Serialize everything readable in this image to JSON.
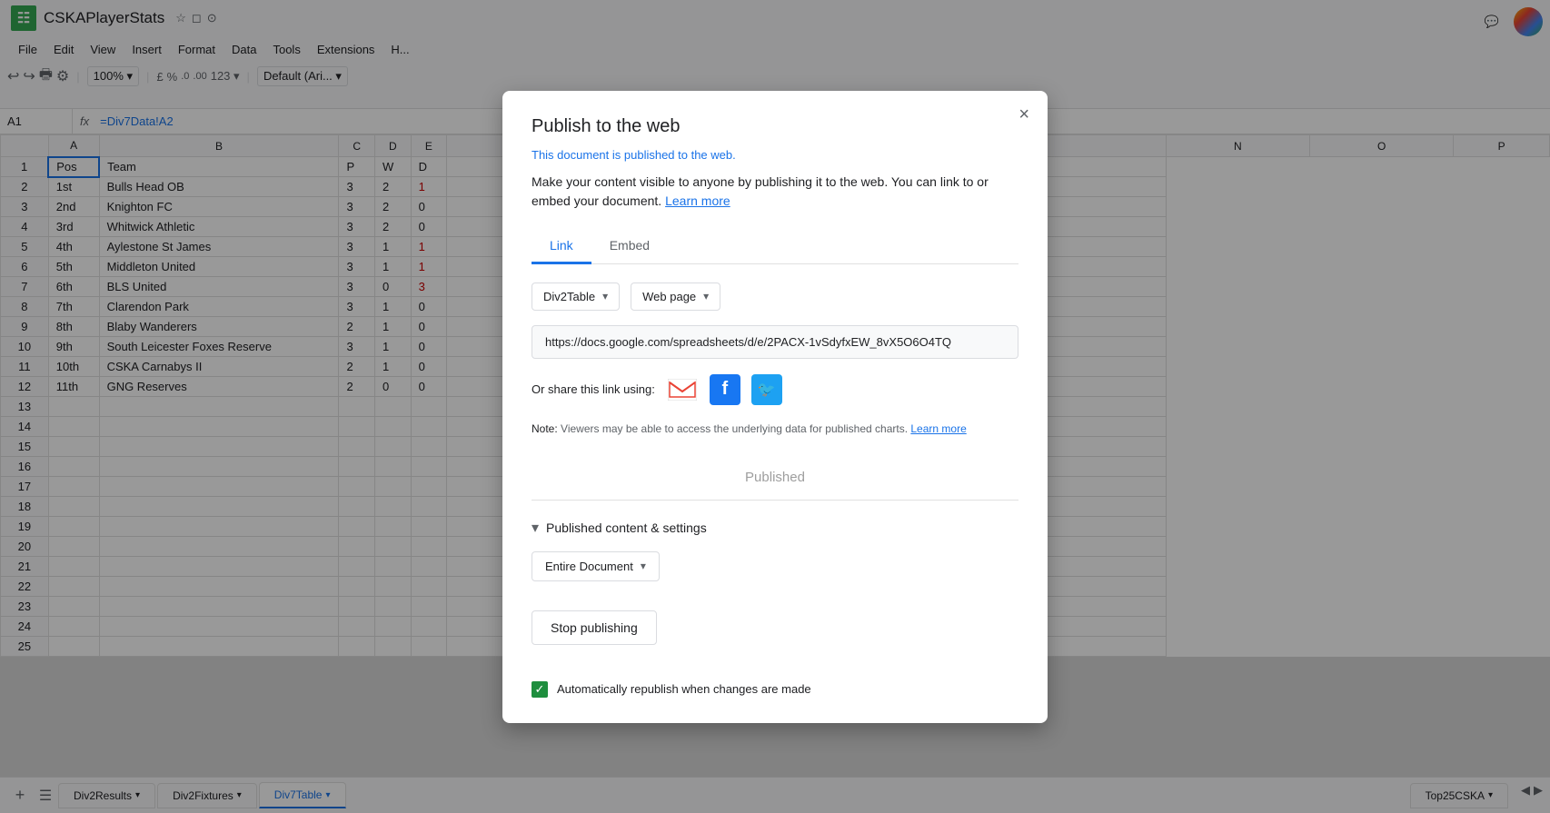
{
  "app": {
    "title": "CSKAPlayerStats",
    "icon": "📊"
  },
  "menubar": {
    "items": [
      "File",
      "Edit",
      "View",
      "Insert",
      "Format",
      "Data",
      "Tools",
      "Extensions",
      "H..."
    ]
  },
  "formula_bar": {
    "cell_ref": "A1",
    "fx": "fx",
    "formula": "=Div7Data!A2"
  },
  "spreadsheet": {
    "col_headers": [
      "",
      "A",
      "B",
      "C",
      "D",
      "E",
      "",
      "",
      "",
      "",
      "",
      "",
      "",
      "N",
      "O",
      "P"
    ],
    "rows": [
      {
        "row": "1",
        "a": "Pos",
        "b": "Team",
        "c": "P",
        "d": "W",
        "e": "D"
      },
      {
        "row": "2",
        "a": "1st",
        "b": "Bulls Head OB",
        "c": "3",
        "d": "2",
        "e": "1"
      },
      {
        "row": "3",
        "a": "2nd",
        "b": "Knighton FC",
        "c": "3",
        "d": "2",
        "e": "0"
      },
      {
        "row": "4",
        "a": "3rd",
        "b": "Whitwick Athletic",
        "c": "3",
        "d": "2",
        "e": "0"
      },
      {
        "row": "5",
        "a": "4th",
        "b": "Aylestone St James",
        "c": "3",
        "d": "1",
        "e": "1"
      },
      {
        "row": "6",
        "a": "5th",
        "b": "Middleton United",
        "c": "3",
        "d": "1",
        "e": "1"
      },
      {
        "row": "7",
        "a": "6th",
        "b": "BLS United",
        "c": "3",
        "d": "0",
        "e": "3"
      },
      {
        "row": "8",
        "a": "7th",
        "b": "Clarendon Park",
        "c": "3",
        "d": "1",
        "e": "0"
      },
      {
        "row": "9",
        "a": "8th",
        "b": "Blaby Wanderers",
        "c": "2",
        "d": "1",
        "e": "0"
      },
      {
        "row": "10",
        "a": "9th",
        "b": "South Leicester Foxes Reserve",
        "c": "3",
        "d": "1",
        "e": "0"
      },
      {
        "row": "11",
        "a": "10th",
        "b": "CSKA Carnabys II",
        "c": "2",
        "d": "1",
        "e": "0"
      },
      {
        "row": "12",
        "a": "11th",
        "b": "GNG Reserves",
        "c": "2",
        "d": "0",
        "e": "0"
      },
      {
        "row": "13",
        "a": "",
        "b": "",
        "c": "",
        "d": "",
        "e": ""
      },
      {
        "row": "14",
        "a": "",
        "b": "",
        "c": "",
        "d": "",
        "e": ""
      },
      {
        "row": "15",
        "a": "",
        "b": "",
        "c": "",
        "d": "",
        "e": ""
      },
      {
        "row": "16",
        "a": "",
        "b": "",
        "c": "",
        "d": "",
        "e": ""
      },
      {
        "row": "17",
        "a": "",
        "b": "",
        "c": "",
        "d": "",
        "e": ""
      },
      {
        "row": "18",
        "a": "",
        "b": "",
        "c": "",
        "d": "",
        "e": ""
      },
      {
        "row": "19",
        "a": "",
        "b": "",
        "c": "",
        "d": "",
        "e": ""
      },
      {
        "row": "20",
        "a": "",
        "b": "",
        "c": "",
        "d": "",
        "e": ""
      },
      {
        "row": "21",
        "a": "",
        "b": "",
        "c": "",
        "d": "",
        "e": ""
      },
      {
        "row": "22",
        "a": "",
        "b": "",
        "c": "",
        "d": "",
        "e": ""
      },
      {
        "row": "23",
        "a": "",
        "b": "",
        "c": "",
        "d": "",
        "e": ""
      },
      {
        "row": "24",
        "a": "",
        "b": "",
        "c": "",
        "d": "",
        "e": ""
      },
      {
        "row": "25",
        "a": "",
        "b": "",
        "c": "",
        "d": "",
        "e": ""
      }
    ]
  },
  "tabs": [
    {
      "label": "Div2Results",
      "active": false
    },
    {
      "label": "Div2Fixtures",
      "active": false
    },
    {
      "label": "Div7Table",
      "active": true
    },
    {
      "label": "Top25CSKA",
      "active": false
    }
  ],
  "modal": {
    "title": "Publish to the web",
    "close_label": "×",
    "published_notice": "This document is published to the web.",
    "description": "Make your content visible to anyone by publishing it to the web. You can link to or embed your document.",
    "learn_more": "Learn more",
    "tabs": [
      {
        "label": "Link",
        "active": true
      },
      {
        "label": "Embed",
        "active": false
      }
    ],
    "sheet_dropdown": "Div2Table",
    "format_dropdown": "Web page",
    "url": "https://docs.google.com/spreadsheets/d/e/2PACX-1vSdyfxEW_8vX5O6O4TQ",
    "share_label": "Or share this link using:",
    "note_label": "Note:",
    "note_text": "Viewers may be able to access the underlying data for published charts.",
    "note_learn_more": "Learn more",
    "published_status": "Published",
    "published_content_label": "Published content & settings",
    "entire_document": "Entire Document",
    "stop_publishing": "Stop publishing",
    "auto_republish_label": "Automatically republish when changes are made",
    "auto_republish_checked": true
  }
}
